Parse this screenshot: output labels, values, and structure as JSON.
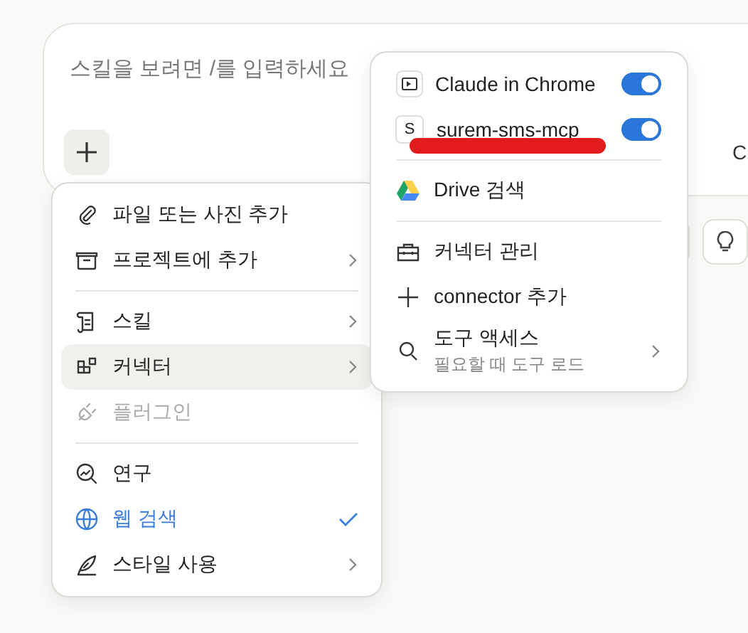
{
  "composer": {
    "placeholder": "스킬을 보려면 /를 입력하세요",
    "model_text": "C"
  },
  "attach_menu": {
    "groups": [
      [
        {
          "label": "파일 또는 사진 추가",
          "submenu": false,
          "selected": false,
          "disabled": false,
          "checked": false
        },
        {
          "label": "프로젝트에 추가",
          "submenu": true,
          "selected": false,
          "disabled": false,
          "checked": false
        }
      ],
      [
        {
          "label": "스킬",
          "submenu": true,
          "selected": false,
          "disabled": false,
          "checked": false
        },
        {
          "label": "커넥터",
          "submenu": true,
          "selected": true,
          "disabled": false,
          "checked": false
        },
        {
          "label": "플러그인",
          "submenu": false,
          "selected": false,
          "disabled": true,
          "checked": false
        }
      ],
      [
        {
          "label": "연구",
          "submenu": false,
          "selected": false,
          "disabled": false,
          "checked": false
        },
        {
          "label": "웹 검색",
          "submenu": false,
          "selected": false,
          "disabled": false,
          "checked": true
        },
        {
          "label": "스타일 사용",
          "submenu": true,
          "selected": false,
          "disabled": false,
          "checked": false
        }
      ]
    ]
  },
  "connector_menu": {
    "toggles": [
      {
        "label": "Claude in Chrome",
        "on": true
      },
      {
        "label": "surem-sms-mcp",
        "badge": "S",
        "on": true
      }
    ],
    "drive": {
      "label": "Drive 검색"
    },
    "actions": [
      {
        "label": "커넥터 관리",
        "submenu": false
      },
      {
        "label": "connector 추가",
        "submenu": false
      },
      {
        "label": "도구 액세스",
        "subtitle": "필요할 때 도구 로드",
        "submenu": true
      }
    ]
  }
}
